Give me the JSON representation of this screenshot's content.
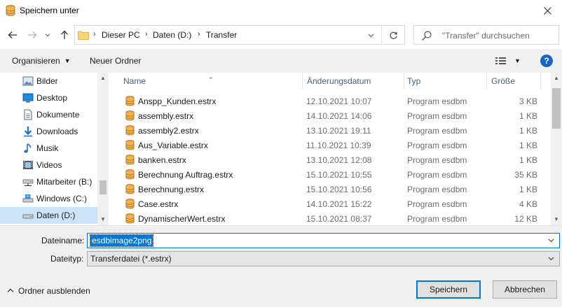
{
  "window": {
    "title": "Speichern unter"
  },
  "address": {
    "crumbs": [
      "Dieser PC",
      "Daten (D:)",
      "Transfer"
    ],
    "search_placeholder": "\"Transfer\" durchsuchen"
  },
  "toolbar": {
    "organize_label": "Organisieren",
    "new_folder_label": "Neuer Ordner"
  },
  "sidebar": {
    "items": [
      {
        "label": "Bilder",
        "icon": "pictures-icon"
      },
      {
        "label": "Desktop",
        "icon": "desktop-icon"
      },
      {
        "label": "Dokumente",
        "icon": "documents-icon"
      },
      {
        "label": "Downloads",
        "icon": "downloads-icon"
      },
      {
        "label": "Musik",
        "icon": "music-icon"
      },
      {
        "label": "Videos",
        "icon": "videos-icon"
      },
      {
        "label": "Mitarbeiter (B:)",
        "icon": "network-drive-icon"
      },
      {
        "label": "Windows (C:)",
        "icon": "windows-drive-icon"
      },
      {
        "label": "Daten (D:)",
        "icon": "drive-icon",
        "selected": true
      }
    ]
  },
  "filelist": {
    "columns": {
      "name": "Name",
      "date": "Änderungsdatum",
      "type": "Typ",
      "size": "Größe"
    },
    "rows": [
      {
        "name": "Anspp_Kunden.estrx",
        "date": "12.10.2021 10:07",
        "type": "Program esdbm",
        "size": "3 KB"
      },
      {
        "name": "assembly.estrx",
        "date": "14.10.2021 14:06",
        "type": "Program esdbm",
        "size": "1 KB"
      },
      {
        "name": "assembly2.estrx",
        "date": "13.10.2021 19:11",
        "type": "Program esdbm",
        "size": "1 KB"
      },
      {
        "name": "Aus_Variable.estrx",
        "date": "11.10.2021 10:39",
        "type": "Program esdbm",
        "size": "1 KB"
      },
      {
        "name": "banken.estrx",
        "date": "13.10.2021 12:08",
        "type": "Program esdbm",
        "size": "1 KB"
      },
      {
        "name": "Berechnung Auftrag.estrx",
        "date": "15.10.2021 10:55",
        "type": "Program esdbm",
        "size": "35 KB"
      },
      {
        "name": "Berechnung.estrx",
        "date": "15.10.2021 10:56",
        "type": "Program esdbm",
        "size": "1 KB"
      },
      {
        "name": "Case.estrx",
        "date": "14.10.2021 15:22",
        "type": "Program esdbm",
        "size": "4 KB"
      },
      {
        "name": "DynamischerWert.estrx",
        "date": "15.10.2021 08:37",
        "type": "Program esdbm",
        "size": "12 KB"
      }
    ]
  },
  "form": {
    "filename_label": "Dateiname:",
    "filename_value": "esdbimage2png",
    "filetype_label": "Dateityp:",
    "filetype_value": "Transferdatei (*.estrx)"
  },
  "footer": {
    "hide_folders_label": "Ordner ausblenden",
    "save_label": "Speichern",
    "cancel_label": "Abbrechen"
  },
  "colors": {
    "accent": "#0078d7",
    "selection": "#cce4f7",
    "help": "#1467c9"
  }
}
